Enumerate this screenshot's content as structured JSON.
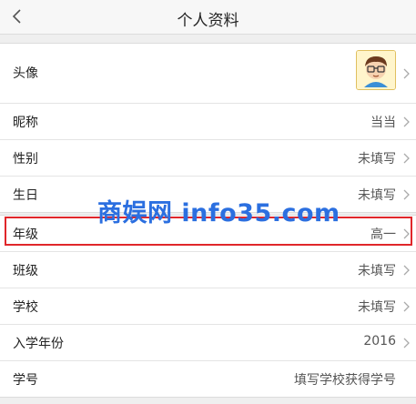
{
  "header": {
    "title": "个人资料",
    "back_icon": "chevron-left-icon"
  },
  "profile": {
    "avatar": {
      "label": "头像",
      "icon": "cartoon-boy-avatar"
    },
    "nickname": {
      "label": "昵称",
      "value": "当当"
    },
    "gender": {
      "label": "性别",
      "value": "未填写"
    },
    "birthday": {
      "label": "生日",
      "value": "未填写"
    }
  },
  "school_info": {
    "grade": {
      "label": "年级",
      "value": "高一"
    },
    "class": {
      "label": "班级",
      "value": "未填写"
    },
    "school": {
      "label": "学校",
      "value": "未填写"
    },
    "enrollment_year": {
      "label": "入学年份",
      "value": "2016"
    },
    "student_id": {
      "label": "学号",
      "value": "填写学校获得学号"
    }
  },
  "watermark": "商娱网 info35.com",
  "colors": {
    "highlight": "#e0262a",
    "watermark": "#2b6fe0",
    "background": "#efefef"
  }
}
